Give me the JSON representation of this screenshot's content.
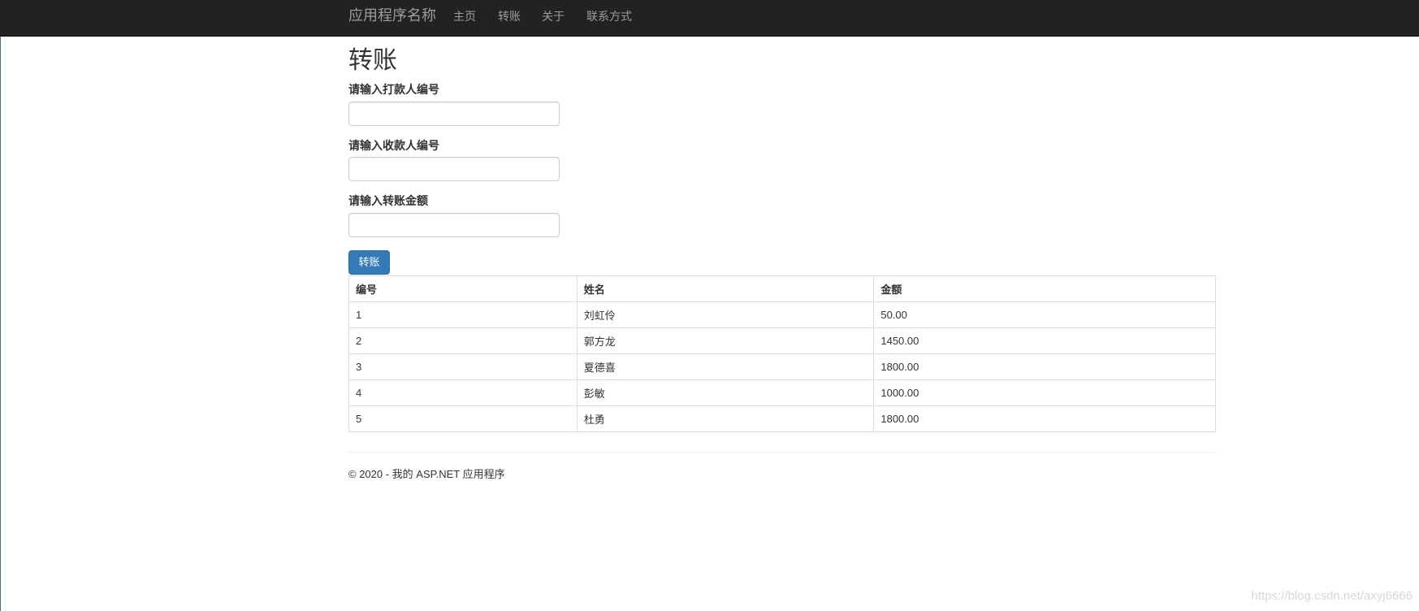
{
  "navbar": {
    "brand": "应用程序名称",
    "items": [
      {
        "label": "主页"
      },
      {
        "label": "转账"
      },
      {
        "label": "关于"
      },
      {
        "label": "联系方式"
      }
    ]
  },
  "page": {
    "title": "转账"
  },
  "form": {
    "payer_label": "请输入打款人编号",
    "payer_value": "",
    "payee_label": "请输入收款人编号",
    "payee_value": "",
    "amount_label": "请输入转账金额",
    "amount_value": "",
    "submit_label": "转账"
  },
  "table": {
    "headers": [
      "编号",
      "姓名",
      "金额"
    ],
    "rows": [
      [
        "1",
        "刘虹伶",
        "50.00"
      ],
      [
        "2",
        "郭方龙",
        "1450.00"
      ],
      [
        "3",
        "夏德喜",
        "1800.00"
      ],
      [
        "4",
        "彭敏",
        "1000.00"
      ],
      [
        "5",
        "杜勇",
        "1800.00"
      ]
    ]
  },
  "footer": {
    "text": "© 2020 - 我的 ASP.NET 应用程序"
  },
  "watermark": "https://blog.csdn.net/axyj6666",
  "colors": {
    "navbar_bg": "#222222",
    "nav_text": "#9d9d9d",
    "primary_button": "#337ab7"
  }
}
